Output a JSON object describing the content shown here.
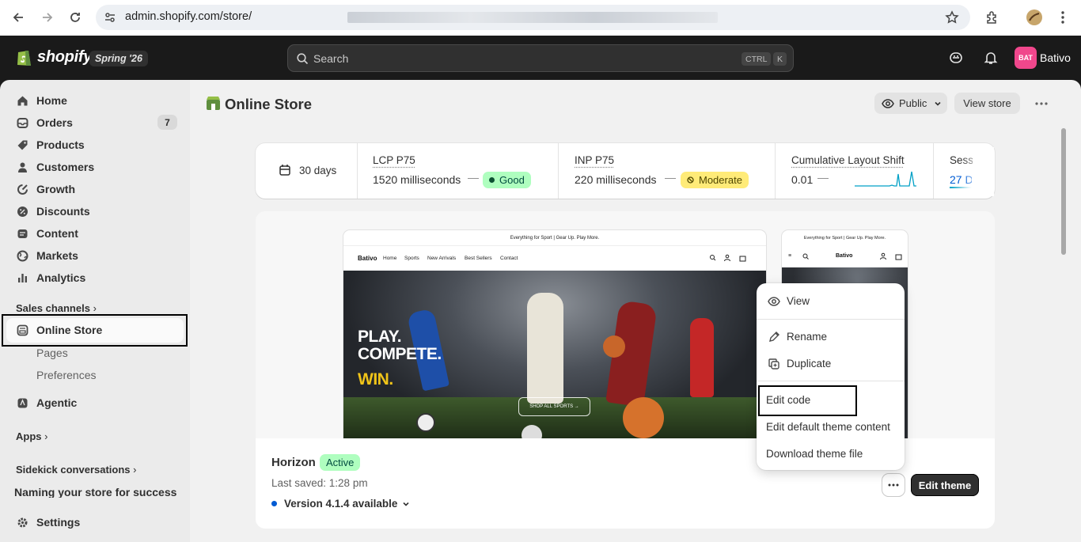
{
  "browser": {
    "url": "admin.shopify.com/store/",
    "url_tail": "....",
    "back_icon": "back-arrow-icon",
    "forward_icon": "forward-arrow-icon",
    "reload_icon": "reload-icon"
  },
  "topbar": {
    "logo": "shopify",
    "edition": "Spring '26",
    "search_placeholder": "Search",
    "shortcut_key1": "CTRL",
    "shortcut_key2": "K",
    "avatar_initials": "BAT",
    "user_name": "Bativo"
  },
  "sidebar": {
    "items": [
      {
        "label": "Home",
        "icon": "home-icon"
      },
      {
        "label": "Orders",
        "icon": "orders-icon",
        "badge": "7"
      },
      {
        "label": "Products",
        "icon": "tag-icon"
      },
      {
        "label": "Customers",
        "icon": "person-icon"
      },
      {
        "label": "Growth",
        "icon": "growth-icon"
      },
      {
        "label": "Discounts",
        "icon": "discount-icon"
      },
      {
        "label": "Content",
        "icon": "content-icon"
      },
      {
        "label": "Markets",
        "icon": "globe-icon"
      },
      {
        "label": "Analytics",
        "icon": "analytics-icon"
      }
    ],
    "sales_channels": "Sales channels",
    "online_store": "Online Store",
    "pages": "Pages",
    "preferences": "Preferences",
    "agentic": "Agentic",
    "apps": "Apps",
    "sidekick": "Sidekick conversations",
    "sidekick_item": "Naming your store for success",
    "settings": "Settings"
  },
  "header": {
    "title": "Online Store",
    "visibility": "Public",
    "view_store": "View store"
  },
  "metrics": {
    "range": "30 days",
    "lcp_label": "LCP P75",
    "lcp_value": "1520 milliseconds",
    "lcp_status": "Good",
    "inp_label": "INP P75",
    "inp_value": "220 milliseconds",
    "inp_status": "Moderate",
    "cls_label": "Cumulative Layout Shift",
    "cls_value": "0.01",
    "sess_label": "Sess",
    "sess_value": "27 D",
    "colors": {
      "good": "#affebf",
      "moderate": "#ffeb78",
      "spark": "#00a0c6"
    }
  },
  "preview": {
    "announcement": "Everything for Sport | Gear Up. Play More.",
    "brand": "Bativo",
    "nav": [
      "Home",
      "Sports",
      "New Arrivals",
      "Best Sellers",
      "Contact"
    ],
    "hero_line1": "PLAY.",
    "hero_line2": "COMPETE.",
    "hero_line3": "WIN.",
    "cta": "SHOP ALL SPORTS →"
  },
  "theme": {
    "name": "Horizon",
    "status": "Active",
    "last_saved": "Last saved: 1:28 pm",
    "version": "Version 4.1.4 available",
    "edit_button": "Edit theme"
  },
  "menu": {
    "view": "View",
    "rename": "Rename",
    "duplicate": "Duplicate",
    "edit_code": "Edit code",
    "edit_default": "Edit default theme content",
    "download": "Download theme file"
  }
}
